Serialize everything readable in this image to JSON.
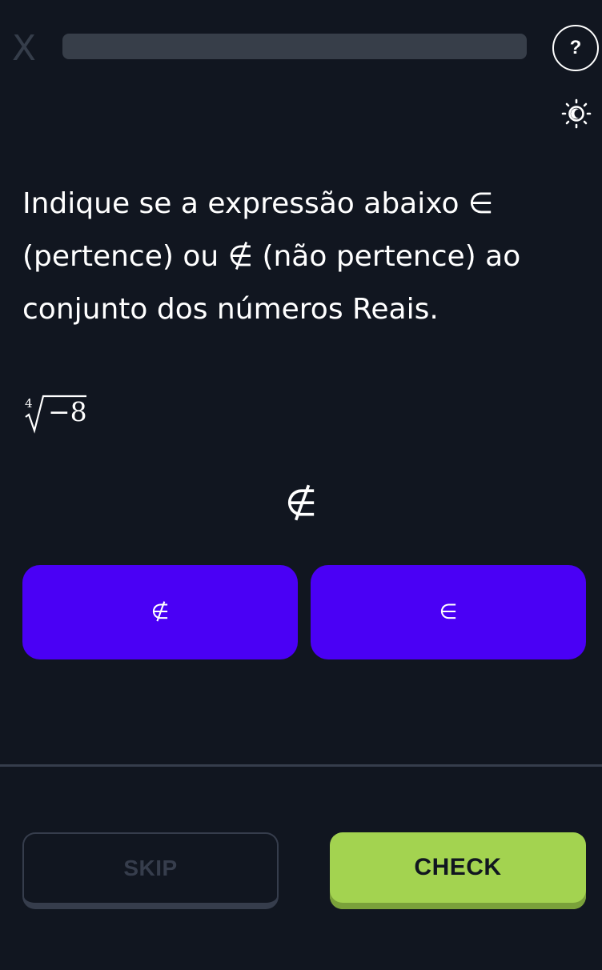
{
  "header": {
    "close_label": "X",
    "help_label": "?",
    "progress_percent": 0,
    "theme_icon": "sun-moon-icon"
  },
  "question": {
    "line1": "Indique se a expressão abaixo ∈",
    "line2": "(pertence) ou ∉ (não pertence) ao",
    "line3": "conjunto dos números Reais."
  },
  "expression": {
    "index": "4",
    "radicand": "−8"
  },
  "answer": {
    "selected": "∉"
  },
  "options": [
    {
      "label": "∉"
    },
    {
      "label": "∈"
    }
  ],
  "footer": {
    "skip_label": "SKIP",
    "check_label": "CHECK"
  },
  "colors": {
    "background": "#111620",
    "option": "#4a00f5",
    "check": "#a3d350",
    "muted": "#363d4c"
  }
}
